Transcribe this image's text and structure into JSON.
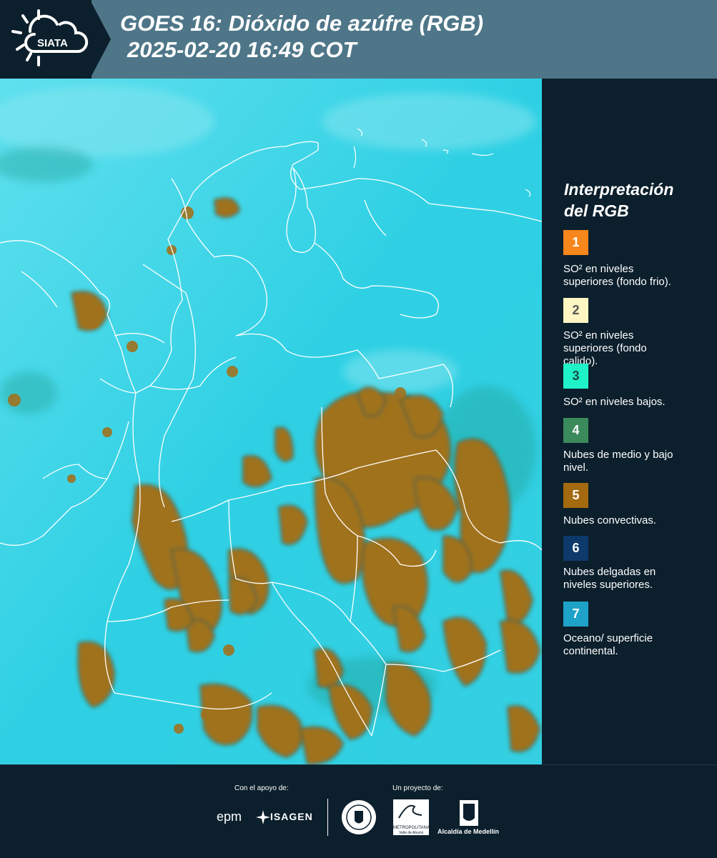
{
  "header": {
    "logo_text": "SIATA",
    "title_line1": "GOES 16: Dióxido de azúfre (RGB)",
    "title_line2": "2025-02-20 16:49 COT"
  },
  "legend": {
    "title_line1": "Interpretación",
    "title_line2": "del RGB",
    "items": [
      {
        "num": "1",
        "color": "#f7861c",
        "text_color": "#ffffff",
        "label_line1": "SO² en niveles",
        "label_line2": "superiores (fondo frio)."
      },
      {
        "num": "2",
        "color": "#fdf5c2",
        "text_color": "#555555",
        "label_line1": "SO² en niveles",
        "label_line2": "superiores (fondo",
        "label_line3": "calido)."
      },
      {
        "num": "3",
        "color": "#1ff2c8",
        "text_color": "#1a4a4a",
        "label_line1": "SO² en niveles bajos."
      },
      {
        "num": "4",
        "color": "#3b8a5c",
        "text_color": "#ffffff",
        "label_line1": "Nubes de medio y bajo",
        "label_line2": "nivel."
      },
      {
        "num": "5",
        "color": "#a36a10",
        "text_color": "#ffffff",
        "label_line1": "Nubes convectivas."
      },
      {
        "num": "6",
        "color": "#0d3a6b",
        "text_color": "#ffffff",
        "label_line1": "Nubes delgadas en",
        "label_line2": "niveles superiores."
      },
      {
        "num": "7",
        "color": "#1ea2c8",
        "text_color": "#ffffff",
        "label_line1": "Oceano/ superficie",
        "label_line2": "continental."
      }
    ]
  },
  "footer": {
    "support_label": "Con el apoyo de:",
    "project_label": "Un proyecto de:",
    "epm_label": "epm",
    "isagen_label": "ISAGEN",
    "metropolitana_label": "METROPOLITANA",
    "metropolitana_sub": "Valle de Aburrá",
    "alcaldia_label": "Alcaldía de Medellín"
  }
}
